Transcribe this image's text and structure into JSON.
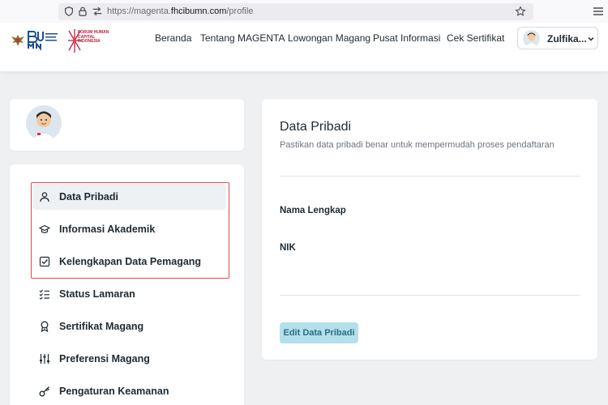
{
  "browser": {
    "url_prefix": "https://magenta.",
    "url_domain": "fhcibumn.com",
    "url_path": "/profile"
  },
  "header": {
    "fhci_logo_text": "FORUM HUMAN CAPITAL INDONESIA",
    "nav": [
      "Beranda",
      "Tentang MAGENTA",
      "Lowongan Magang",
      "Pusat Informasi",
      "Cek Sertifikat"
    ],
    "user_name": "Zulfika..."
  },
  "sidebar": {
    "items": [
      {
        "label": "Data Pribadi",
        "icon": "user-icon"
      },
      {
        "label": "Informasi Akademik",
        "icon": "graduation-cap-icon"
      },
      {
        "label": "Kelengkapan Data Pemagang",
        "icon": "checkbox-icon"
      },
      {
        "label": "Status Lamaran",
        "icon": "checklist-icon"
      },
      {
        "label": "Sertifikat Magang",
        "icon": "award-icon"
      },
      {
        "label": "Preferensi Magang",
        "icon": "sliders-icon"
      },
      {
        "label": "Pengaturan Keamanan",
        "icon": "key-icon"
      }
    ]
  },
  "main": {
    "title": "Data Pribadi",
    "subtitle": "Pastikan data pribadi benar untuk mempermudah proses pendaftaran",
    "fields": [
      "Nama Lengkap",
      "NIK"
    ],
    "edit_button": "Edit Data Pribadi"
  },
  "colors": {
    "accent_button_bg": "#b3e0ea",
    "accent_button_text": "#2c6b86",
    "highlight_border": "#e0494d",
    "page_bg": "#eef0f2"
  }
}
